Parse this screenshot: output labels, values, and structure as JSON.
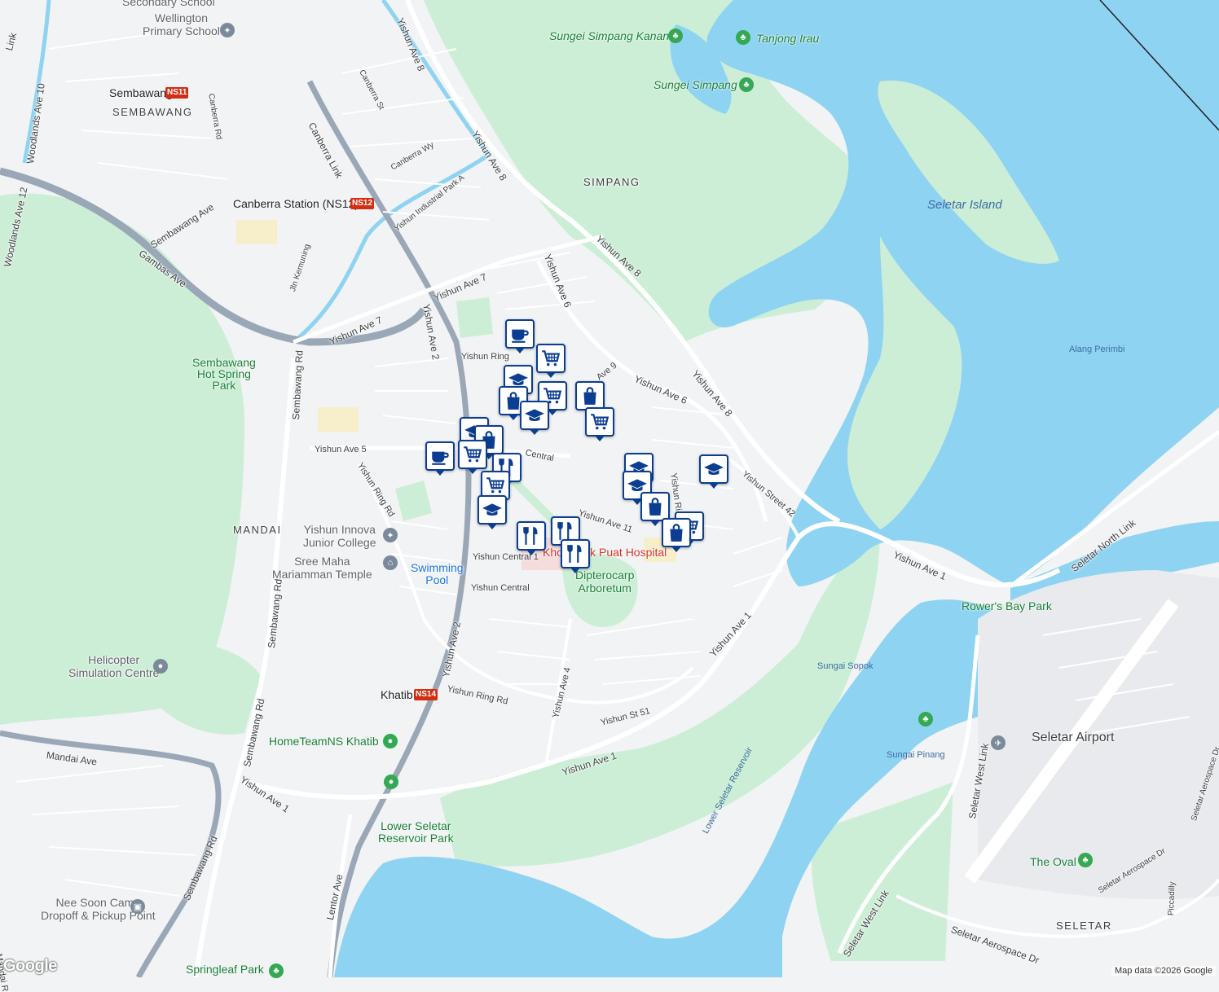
{
  "map": {
    "colors": {
      "land": "#f1f3f4",
      "water": "#8fd3f2",
      "park": "#cdeed6",
      "road": "#ffffff",
      "highway": "#9aa7b6",
      "marker": "#0b3d91",
      "mrt": "#d42e12"
    },
    "area_labels": [
      "SEMBAWANG",
      "SIMPANG",
      "MANDAI",
      "SELETAR"
    ],
    "place_labels": {
      "wellington": "Wellington\nPrimary School",
      "secondary": "Secondary School",
      "sembawang_mrt": "Sembawang",
      "sembawang_code": "NS11",
      "canberra_station": "Canberra Station (NS12)",
      "canberra_code": "NS12",
      "khatib": "Khatib",
      "khatib_code": "NS14",
      "hot_spring": "Sembawang\nHot Spring\nPark",
      "innova": "Yishun Innova\nJunior College",
      "temple": "Sree Maha\nMariamman Temple",
      "swimming": "Swimming\nPool",
      "heli": "Helicopter\nSimulation Centre",
      "hometeam": "HomeTeamNS Khatib",
      "lower_seletar_park": "Lower Seletar\nReservoir Park",
      "nee_soon": "Nee Soon Camp\nDropoff & Pickup Point",
      "springleaf": "Springleaf Park",
      "hospital": "Khoo Teck Puat Hospital",
      "dipterocarp": "Dipterocarp\nArboretum",
      "sungei_kanan": "Sungei Simpang Kanan",
      "tanjong_irau": "Tanjong Irau",
      "sungei_simpang": "Sungei Simpang",
      "seletar_island": "Seletar Island",
      "alang_perimbi": "Alang Perimbi",
      "rowers_bay": "Rower's Bay Park",
      "sungai_sopok": "Sungai Sopok",
      "sungai_pinang": "Sungai Pinang",
      "seletar_airport": "Seletar Airport",
      "the_oval": "The Oval",
      "lower_seletar_res": "Lower Seletar Reservoir"
    },
    "street_labels": {
      "yishun_ave8_a": "Yishun Ave 8",
      "yishun_ave8_b": "Yishun Ave 8",
      "yishun_ave8_c": "Yishun Ave 8",
      "yishun_ave8_d": "Yishun Ave 8",
      "canberra_st": "Canberra St",
      "canberra_rd": "Canberra Rd",
      "canberra_link": "Canberra Link",
      "canberra_wy": "Canberra Wy",
      "yishun_ind": "Yishun Industrial Park A",
      "woodlands_ave10": "Woodlands Ave 10",
      "woodlands_ave12": "Woodlands Ave 12",
      "link": "Link",
      "sembawang_ave": "Sembawang Ave",
      "gambas_ave": "Gambas Ave",
      "jln_kemuning": "Jln Kemuning",
      "yishun_ave7_a": "Yishun Ave 7",
      "yishun_ave7_b": "Yishun Ave 7",
      "yishun_ave6_a": "Yishun Ave 6",
      "yishun_ave6_b": "Yishun Ave 6",
      "yishun_ave2_a": "Yishun Ave 2",
      "yishun_ave2_b": "Yishun Ave 2",
      "yishun_ring_a": "Yishun Ring",
      "yishun_ring_b": "Yishun Ring Rd",
      "yishun_ring_c": "Yishun Ring Rd",
      "yishun_ave9": "Ave 9",
      "yishun_ave5": "Yishun Ave 5",
      "yishun_central_a": "Central",
      "yishun_central_b": "Yishun Central",
      "yishun_central_1": "Yishun Central 1",
      "yishun_ave11": "Yishun Ave 11",
      "yishun_st42": "Yishun Street 42",
      "yishun_ri": "Yishun Ri",
      "yishun_ave1_a": "Yishun Ave 1",
      "yishun_ave1_b": "Yishun Ave 1",
      "yishun_ave1_c": "Yishun Ave 1",
      "yishun_ave1_d": "Yishun Ave 1",
      "yishun_ave4": "Yishun Ave 4",
      "yishun_st51": "Yishun St 51",
      "sembawang_rd_a": "Sembawang Rd",
      "sembawang_rd_b": "Sembawang Rd",
      "sembawang_rd_c": "Sembawang Rd",
      "sembawang_rd_d": "Sembawang Rd",
      "mandai_ave": "Mandai Ave",
      "lentor_ave": "Lentor Ave",
      "seletar_west_link_a": "Seletar West Link",
      "seletar_west_link_b": "Seletar West Link",
      "seletar_north_link": "Seletar North Link",
      "seletar_aero_a": "Seletar Aerospace Dr",
      "seletar_aero_b": "Seletar Aerospace Dr",
      "seletar_aero_c": "Seletar Aerospace Dr",
      "piccadilly": "Piccadilly",
      "mandai_rd": "Mandai R"
    },
    "markers": [
      {
        "icon": "cafe"
      },
      {
        "icon": "cart"
      },
      {
        "icon": "school"
      },
      {
        "icon": "shop"
      },
      {
        "icon": "cart"
      },
      {
        "icon": "shop"
      },
      {
        "icon": "school"
      },
      {
        "icon": "cart"
      },
      {
        "icon": "school"
      },
      {
        "icon": "shop"
      },
      {
        "icon": "cafe"
      },
      {
        "icon": "cart"
      },
      {
        "icon": "food"
      },
      {
        "icon": "cart"
      },
      {
        "icon": "school"
      },
      {
        "icon": "food"
      },
      {
        "icon": "food"
      },
      {
        "icon": "food"
      },
      {
        "icon": "school"
      },
      {
        "icon": "school"
      },
      {
        "icon": "shop"
      },
      {
        "icon": "cart"
      },
      {
        "icon": "shop"
      },
      {
        "icon": "school"
      }
    ],
    "attribution": "Map data ©2026 Google",
    "logo": "Google"
  }
}
